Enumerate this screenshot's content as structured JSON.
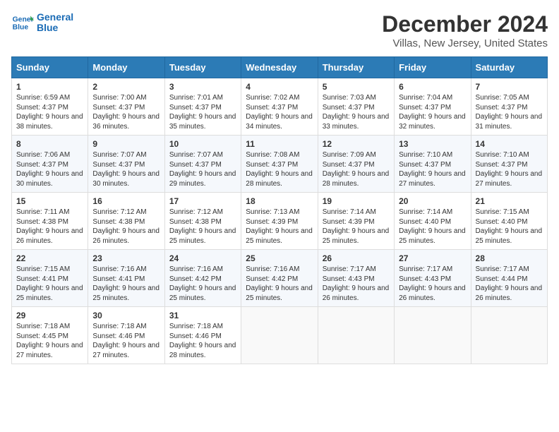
{
  "header": {
    "logo_line1": "General",
    "logo_line2": "Blue",
    "title": "December 2024",
    "subtitle": "Villas, New Jersey, United States"
  },
  "calendar": {
    "days_of_week": [
      "Sunday",
      "Monday",
      "Tuesday",
      "Wednesday",
      "Thursday",
      "Friday",
      "Saturday"
    ],
    "weeks": [
      [
        {
          "day": "",
          "empty": true
        },
        {
          "day": "",
          "empty": true
        },
        {
          "day": "",
          "empty": true
        },
        {
          "day": "",
          "empty": true
        },
        {
          "day": "",
          "empty": true
        },
        {
          "day": "",
          "empty": true
        },
        {
          "day": "",
          "empty": true
        }
      ]
    ],
    "cells": [
      {
        "date": "1",
        "sunrise": "6:59 AM",
        "sunset": "4:37 PM",
        "daylight": "9 hours and 38 minutes."
      },
      {
        "date": "2",
        "sunrise": "7:00 AM",
        "sunset": "4:37 PM",
        "daylight": "9 hours and 36 minutes."
      },
      {
        "date": "3",
        "sunrise": "7:01 AM",
        "sunset": "4:37 PM",
        "daylight": "9 hours and 35 minutes."
      },
      {
        "date": "4",
        "sunrise": "7:02 AM",
        "sunset": "4:37 PM",
        "daylight": "9 hours and 34 minutes."
      },
      {
        "date": "5",
        "sunrise": "7:03 AM",
        "sunset": "4:37 PM",
        "daylight": "9 hours and 33 minutes."
      },
      {
        "date": "6",
        "sunrise": "7:04 AM",
        "sunset": "4:37 PM",
        "daylight": "9 hours and 32 minutes."
      },
      {
        "date": "7",
        "sunrise": "7:05 AM",
        "sunset": "4:37 PM",
        "daylight": "9 hours and 31 minutes."
      },
      {
        "date": "8",
        "sunrise": "7:06 AM",
        "sunset": "4:37 PM",
        "daylight": "9 hours and 30 minutes."
      },
      {
        "date": "9",
        "sunrise": "7:07 AM",
        "sunset": "4:37 PM",
        "daylight": "9 hours and 30 minutes."
      },
      {
        "date": "10",
        "sunrise": "7:07 AM",
        "sunset": "4:37 PM",
        "daylight": "9 hours and 29 minutes."
      },
      {
        "date": "11",
        "sunrise": "7:08 AM",
        "sunset": "4:37 PM",
        "daylight": "9 hours and 28 minutes."
      },
      {
        "date": "12",
        "sunrise": "7:09 AM",
        "sunset": "4:37 PM",
        "daylight": "9 hours and 28 minutes."
      },
      {
        "date": "13",
        "sunrise": "7:10 AM",
        "sunset": "4:37 PM",
        "daylight": "9 hours and 27 minutes."
      },
      {
        "date": "14",
        "sunrise": "7:10 AM",
        "sunset": "4:37 PM",
        "daylight": "9 hours and 27 minutes."
      },
      {
        "date": "15",
        "sunrise": "7:11 AM",
        "sunset": "4:38 PM",
        "daylight": "9 hours and 26 minutes."
      },
      {
        "date": "16",
        "sunrise": "7:12 AM",
        "sunset": "4:38 PM",
        "daylight": "9 hours and 26 minutes."
      },
      {
        "date": "17",
        "sunrise": "7:12 AM",
        "sunset": "4:38 PM",
        "daylight": "9 hours and 25 minutes."
      },
      {
        "date": "18",
        "sunrise": "7:13 AM",
        "sunset": "4:39 PM",
        "daylight": "9 hours and 25 minutes."
      },
      {
        "date": "19",
        "sunrise": "7:14 AM",
        "sunset": "4:39 PM",
        "daylight": "9 hours and 25 minutes."
      },
      {
        "date": "20",
        "sunrise": "7:14 AM",
        "sunset": "4:40 PM",
        "daylight": "9 hours and 25 minutes."
      },
      {
        "date": "21",
        "sunrise": "7:15 AM",
        "sunset": "4:40 PM",
        "daylight": "9 hours and 25 minutes."
      },
      {
        "date": "22",
        "sunrise": "7:15 AM",
        "sunset": "4:41 PM",
        "daylight": "9 hours and 25 minutes."
      },
      {
        "date": "23",
        "sunrise": "7:16 AM",
        "sunset": "4:41 PM",
        "daylight": "9 hours and 25 minutes."
      },
      {
        "date": "24",
        "sunrise": "7:16 AM",
        "sunset": "4:42 PM",
        "daylight": "9 hours and 25 minutes."
      },
      {
        "date": "25",
        "sunrise": "7:16 AM",
        "sunset": "4:42 PM",
        "daylight": "9 hours and 25 minutes."
      },
      {
        "date": "26",
        "sunrise": "7:17 AM",
        "sunset": "4:43 PM",
        "daylight": "9 hours and 26 minutes."
      },
      {
        "date": "27",
        "sunrise": "7:17 AM",
        "sunset": "4:43 PM",
        "daylight": "9 hours and 26 minutes."
      },
      {
        "date": "28",
        "sunrise": "7:17 AM",
        "sunset": "4:44 PM",
        "daylight": "9 hours and 26 minutes."
      },
      {
        "date": "29",
        "sunrise": "7:18 AM",
        "sunset": "4:45 PM",
        "daylight": "9 hours and 27 minutes."
      },
      {
        "date": "30",
        "sunrise": "7:18 AM",
        "sunset": "4:46 PM",
        "daylight": "9 hours and 27 minutes."
      },
      {
        "date": "31",
        "sunrise": "7:18 AM",
        "sunset": "4:46 PM",
        "daylight": "9 hours and 28 minutes."
      }
    ]
  }
}
